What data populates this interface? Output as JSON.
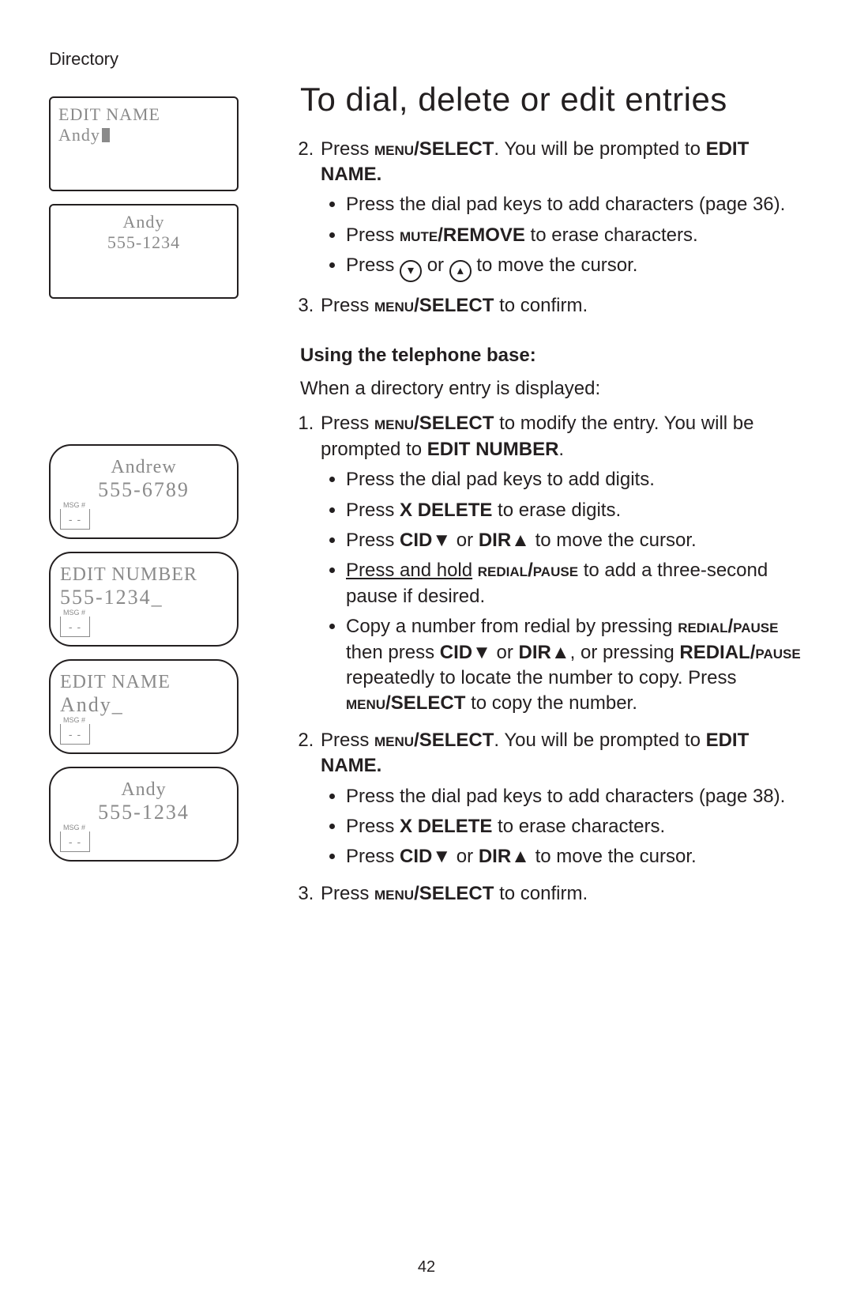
{
  "breadcrumb": "Directory",
  "title": "To dial, delete or edit entries",
  "screens": {
    "hsEditName": {
      "line1": "EDIT NAME",
      "line2": "Andy"
    },
    "hsEntry": {
      "line1": "Andy",
      "line2": "555-1234"
    },
    "baseEntry": {
      "line1": "Andrew",
      "line2": "555-6789"
    },
    "baseEditNum": {
      "line1": "EDIT NUMBER",
      "line2": "555-1234_"
    },
    "baseEditNm": {
      "line1": "EDIT NAME",
      "line2": "Andy_"
    },
    "baseFinal": {
      "line1": "Andy",
      "line2": "555-1234"
    }
  },
  "txt": {
    "step2a": "Press ",
    "menu": "menu",
    "select": "/SELECT",
    "step2b": ". You will be prompted to ",
    "editName": "EDIT NAME.",
    "b1": "Press the dial pad keys to add characters (page 36).",
    "b2a": "Press ",
    "mute": "mute",
    "remove": "/REMOVE",
    "b2b": " to erase characters.",
    "b3a": "Press ",
    "b3b": " or ",
    "b3c": " to move the cursor.",
    "step3a": "Press ",
    "step3b": " to confirm.",
    "subhead": "Using the telephone base:",
    "intro": "When a directory entry is displayed:",
    "t1a": "Press ",
    "t1b": " to modify the entry. You will be prompted to ",
    "editNumber": "EDIT NUMBER",
    "period": ".",
    "u1": "Press the dial pad keys to add digits.",
    "u2a": "Press ",
    "xdelete": "X DELETE",
    "u2b": " to erase digits.",
    "u3a": "Press ",
    "cid": "CID",
    "or": " or ",
    "dir": "DIR",
    "u3b": " to move the cursor.",
    "u4a": "Press and hold",
    "redial": "redial",
    "pause": "/pause",
    "u4b": " to add a three-second pause if desired.",
    "u5a": "Copy a number from redial by pressing ",
    "u5b": " then press ",
    "u5c": ", or pressing ",
    "redialPauseBold": "REDIAL",
    "pauseSmall": "/pause",
    "u5d": " repeatedly to locate the number to copy. Press ",
    "u5e": " to copy the number.",
    "v1": "Press the dial pad keys to add characters (page 38).",
    "v2b": " to erase characters."
  },
  "pagenum": "42"
}
